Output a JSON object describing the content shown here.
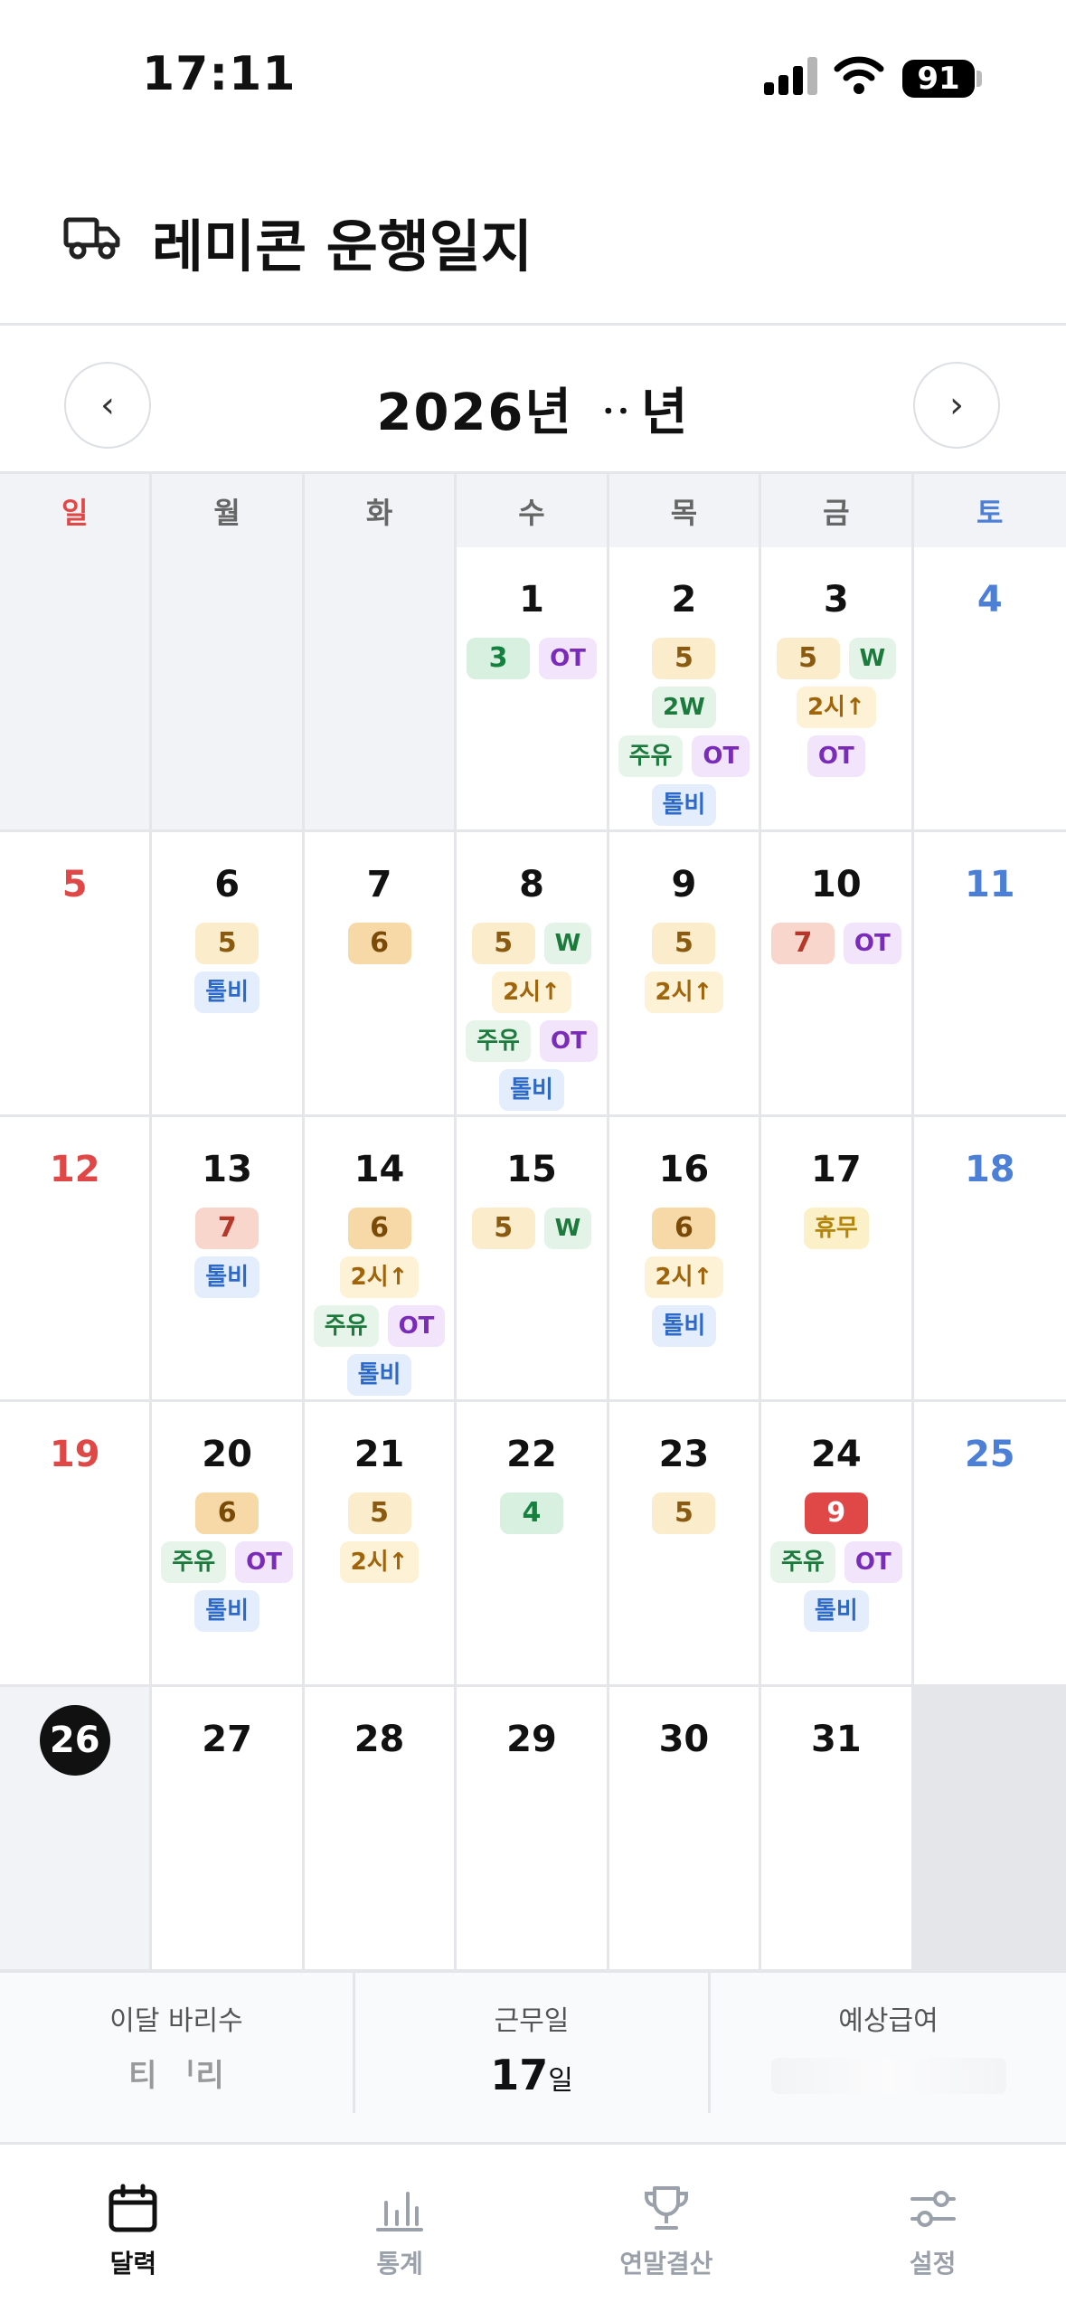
{
  "status_bar": {
    "time": "17:11",
    "battery": "91"
  },
  "header": {
    "title": "레미콘 운행일지",
    "icon": "truck-icon"
  },
  "month_nav": {
    "title": "2026년 ᆢ년",
    "prev": "‹",
    "next": "›"
  },
  "weekdays": [
    "일",
    "월",
    "화",
    "수",
    "목",
    "금",
    "토"
  ],
  "weeks": [
    [
      {
        "day": "",
        "empty": true
      },
      {
        "day": "",
        "empty": true
      },
      {
        "day": "",
        "empty": true
      },
      {
        "day": "1",
        "chips": [
          {
            "t": "3",
            "c": "count c3"
          },
          {
            "t": "OT",
            "c": "ot"
          }
        ]
      },
      {
        "day": "2",
        "chips": [
          {
            "t": "5",
            "c": "count c5"
          },
          {
            "t": "2W",
            "c": "w"
          },
          {
            "t": "주유",
            "c": "juyu"
          },
          {
            "t": "OT",
            "c": "ot"
          },
          {
            "t": "톨비",
            "c": "tolbi"
          }
        ]
      },
      {
        "day": "3",
        "chips": [
          {
            "t": "5",
            "c": "count c5"
          },
          {
            "t": "W",
            "c": "w"
          },
          {
            "t": "2시↑",
            "c": "hr"
          },
          {
            "t": "OT",
            "c": "ot"
          }
        ]
      },
      {
        "day": "4",
        "sat": true
      }
    ],
    [
      {
        "day": "5",
        "sun": true
      },
      {
        "day": "6",
        "chips": [
          {
            "t": "5",
            "c": "count c5"
          },
          {
            "t": "톨비",
            "c": "tolbi"
          }
        ]
      },
      {
        "day": "7",
        "chips": [
          {
            "t": "6",
            "c": "count c6"
          }
        ]
      },
      {
        "day": "8",
        "chips": [
          {
            "t": "5",
            "c": "count c5"
          },
          {
            "t": "W",
            "c": "w"
          },
          {
            "t": "2시↑",
            "c": "hr"
          },
          {
            "t": "주유",
            "c": "juyu"
          },
          {
            "t": "OT",
            "c": "ot"
          },
          {
            "t": "톨비",
            "c": "tolbi"
          }
        ]
      },
      {
        "day": "9",
        "chips": [
          {
            "t": "5",
            "c": "count c5"
          },
          {
            "t": "2시↑",
            "c": "hr"
          }
        ]
      },
      {
        "day": "10",
        "chips": [
          {
            "t": "7",
            "c": "count c7"
          },
          {
            "t": "OT",
            "c": "ot"
          }
        ]
      },
      {
        "day": "11",
        "sat": true
      }
    ],
    [
      {
        "day": "12",
        "sun": true
      },
      {
        "day": "13",
        "chips": [
          {
            "t": "7",
            "c": "count c7"
          },
          {
            "t": "톨비",
            "c": "tolbi"
          }
        ]
      },
      {
        "day": "14",
        "chips": [
          {
            "t": "6",
            "c": "count c6"
          },
          {
            "t": "2시↑",
            "c": "hr"
          },
          {
            "t": "주유",
            "c": "juyu"
          },
          {
            "t": "OT",
            "c": "ot"
          },
          {
            "t": "톨비",
            "c": "tolbi"
          }
        ]
      },
      {
        "day": "15",
        "chips": [
          {
            "t": "5",
            "c": "count c5"
          },
          {
            "t": "W",
            "c": "w"
          }
        ]
      },
      {
        "day": "16",
        "chips": [
          {
            "t": "6",
            "c": "count c6"
          },
          {
            "t": "2시↑",
            "c": "hr"
          },
          {
            "t": "톨비",
            "c": "tolbi"
          }
        ]
      },
      {
        "day": "17",
        "chips": [
          {
            "t": "휴무",
            "c": "hyumu"
          }
        ]
      },
      {
        "day": "18",
        "sat": true
      }
    ],
    [
      {
        "day": "19",
        "sun": true
      },
      {
        "day": "20",
        "chips": [
          {
            "t": "6",
            "c": "count c6"
          },
          {
            "t": "주유",
            "c": "juyu"
          },
          {
            "t": "OT",
            "c": "ot"
          },
          {
            "t": "톨비",
            "c": "tolbi"
          }
        ]
      },
      {
        "day": "21",
        "chips": [
          {
            "t": "5",
            "c": "count c5"
          },
          {
            "t": "2시↑",
            "c": "hr"
          }
        ]
      },
      {
        "day": "22",
        "chips": [
          {
            "t": "4",
            "c": "count c4"
          }
        ]
      },
      {
        "day": "23",
        "chips": [
          {
            "t": "5",
            "c": "count c5"
          }
        ]
      },
      {
        "day": "24",
        "chips": [
          {
            "t": "9",
            "c": "count c9"
          },
          {
            "t": "주유",
            "c": "juyu"
          },
          {
            "t": "OT",
            "c": "ot"
          },
          {
            "t": "톨비",
            "c": "tolbi"
          }
        ]
      },
      {
        "day": "25",
        "sat": true
      }
    ],
    [
      {
        "day": "26",
        "sun": true,
        "today": true
      },
      {
        "day": "27"
      },
      {
        "day": "28"
      },
      {
        "day": "29"
      },
      {
        "day": "30"
      },
      {
        "day": "31"
      },
      {
        "day": "",
        "blank_end": true
      }
    ]
  ],
  "summary": {
    "trips_label": "이달 바리수",
    "trips_value": "티 ᅵ리",
    "workdays_label": "근무일",
    "workdays_value": "17",
    "workdays_unit": "일",
    "pay_label": "예상급여"
  },
  "tabs": [
    {
      "label": "달력",
      "icon": "calendar-icon",
      "active": true
    },
    {
      "label": "통계",
      "icon": "bar-chart-icon",
      "active": false
    },
    {
      "label": "연말결산",
      "icon": "trophy-icon",
      "active": false
    },
    {
      "label": "설정",
      "icon": "sliders-icon",
      "active": false
    }
  ]
}
